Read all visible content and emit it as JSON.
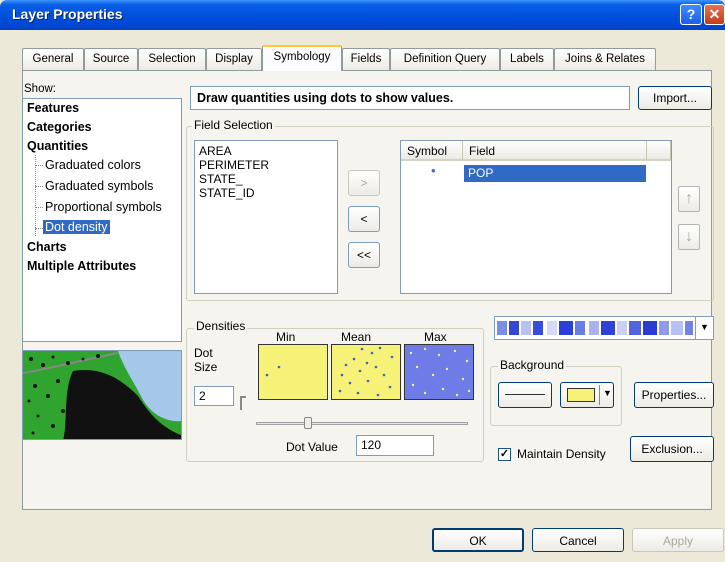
{
  "window": {
    "title": "Layer Properties",
    "help_glyph": "?",
    "close_glyph": "✕"
  },
  "tabs": [
    {
      "label": "General"
    },
    {
      "label": "Source"
    },
    {
      "label": "Selection"
    },
    {
      "label": "Display"
    },
    {
      "label": "Symbology",
      "active": true
    },
    {
      "label": "Fields"
    },
    {
      "label": "Definition Query"
    },
    {
      "label": "Labels"
    },
    {
      "label": "Joins & Relates"
    }
  ],
  "show": {
    "label": "Show:",
    "items": {
      "features": "Features",
      "categories": "Categories",
      "quantities": "Quantities",
      "graduated_colors": "Graduated colors",
      "graduated_symbols": "Graduated symbols",
      "proportional_symbols": "Proportional symbols",
      "dot_density": "Dot density",
      "charts": "Charts",
      "multiple_attributes": "Multiple Attributes"
    },
    "selected": "Dot density"
  },
  "header": {
    "text": "Draw quantities using dots to show values.",
    "import_label": "Import..."
  },
  "field_selection": {
    "label": "Field Selection",
    "available": [
      "AREA",
      "PERIMETER",
      "STATE_",
      "STATE_ID"
    ],
    "move_right": ">",
    "move_left": "<",
    "move_all_left": "<<",
    "columns": {
      "symbol": "Symbol",
      "field": "Field"
    },
    "selected_rows": [
      {
        "symbol": "•",
        "field": "POP"
      }
    ],
    "up_arrow": "↑",
    "down_arrow": "↓"
  },
  "densities": {
    "label": "Densities",
    "min": "Min",
    "mean": "Mean",
    "max": "Max",
    "dot_size_label": "Dot\nSize",
    "dot_size": "2",
    "dot_value_label": "Dot Value",
    "dot_value": "120"
  },
  "background": {
    "label": "Background"
  },
  "properties_label": "Properties...",
  "exclusion_label": "Exclusion...",
  "maintain_density": {
    "label": "Maintain Density",
    "checked": true
  },
  "buttons": {
    "ok": "OK",
    "cancel": "Cancel",
    "apply": "Apply"
  },
  "colors": {
    "swatch_fill": "#f5f277",
    "max_fill": "#6f7ce8",
    "dot": "#4b5fd1",
    "selection": "#316ac5"
  }
}
